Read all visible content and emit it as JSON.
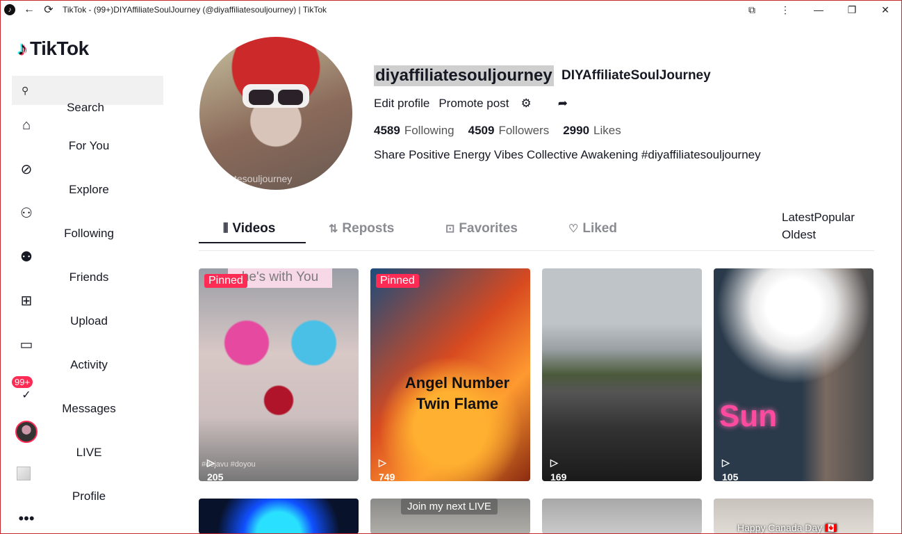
{
  "window": {
    "title": "TikTok - (99+)DIYAffiliateSoulJourney (@diyaffiliatesouljourney) | TikTok"
  },
  "brand": {
    "name": "TikTok"
  },
  "search": {
    "label": "Search"
  },
  "nav": {
    "items": [
      {
        "label": "For You",
        "icon": "home-icon"
      },
      {
        "label": "Explore",
        "icon": "compass-icon"
      },
      {
        "label": "Following",
        "icon": "following-icon"
      },
      {
        "label": "Friends",
        "icon": "friends-icon"
      },
      {
        "label": "Upload",
        "icon": "upload-icon"
      },
      {
        "label": "Activity",
        "icon": "activity-icon"
      },
      {
        "label": "Messages",
        "icon": "messages-icon"
      },
      {
        "label": "LIVE",
        "icon": "live-icon"
      },
      {
        "label": "Profile",
        "icon": "profile-icon"
      }
    ],
    "messages_badge": "99+"
  },
  "profile": {
    "username": "diyaffiliatesouljourney",
    "nickname": "DIYAffiliateSoulJourney",
    "edit_label": "Edit profile",
    "promote_label": "Promote post",
    "following_count": "4589",
    "following_label": "Following",
    "followers_count": "4509",
    "followers_label": "Followers",
    "likes_count": "2990",
    "likes_label": "Likes",
    "bio": "Share Positive Energy Vibes Collective Awakening #diyaffiliatesouljourney",
    "avatar_watermark": "tesouljourney"
  },
  "tabs": [
    {
      "label": "Videos",
      "active": true
    },
    {
      "label": "Reposts",
      "active": false
    },
    {
      "label": "Favorites",
      "active": false
    },
    {
      "label": "Liked",
      "active": false
    }
  ],
  "sort": {
    "options": [
      "Latest",
      "Popular",
      "Oldest"
    ]
  },
  "videos": [
    {
      "pinned": "Pinned",
      "views": "205",
      "overlay": "he's with You",
      "caption": "#dejavu #doyou"
    },
    {
      "pinned": "Pinned",
      "views": "749",
      "overlay": "Angel Number Twin Flame"
    },
    {
      "views": "169"
    },
    {
      "views": "105",
      "overlay": "Sun"
    },
    {},
    {
      "overlay": "Join my next LIVE"
    },
    {},
    {
      "overlay": "Happy Canada Day 🇨🇦"
    }
  ],
  "colors": {
    "accent": "#fe2c55",
    "text": "#161823",
    "muted": "#8a8b91"
  }
}
